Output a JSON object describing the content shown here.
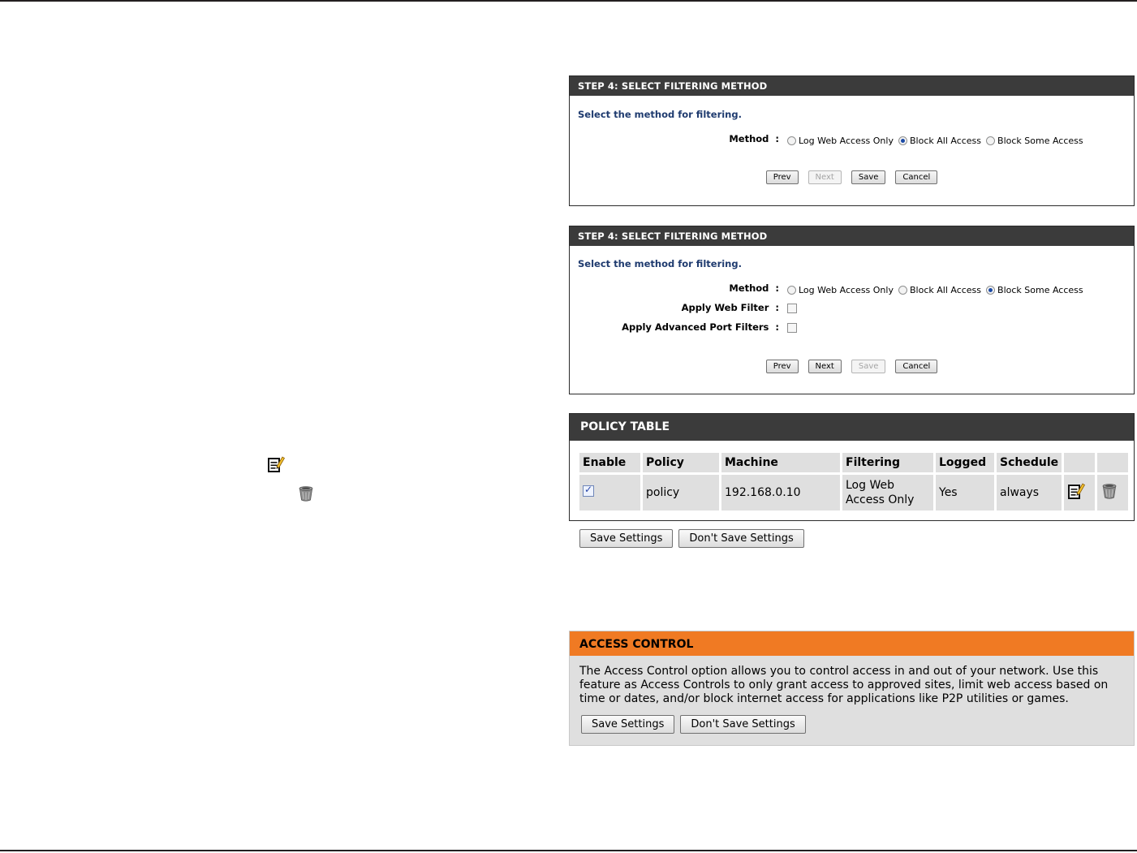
{
  "step_panel_1": {
    "title": "STEP 4: SELECT FILTERING METHOD",
    "subtitle": "Select the method for filtering.",
    "method_label": "Method",
    "options": [
      {
        "label": "Log Web Access Only",
        "selected": false
      },
      {
        "label": "Block All Access",
        "selected": true
      },
      {
        "label": "Block Some Access",
        "selected": false
      }
    ],
    "buttons": {
      "prev": "Prev",
      "next": "Next",
      "save": "Save",
      "cancel": "Cancel"
    }
  },
  "step_panel_2": {
    "title": "STEP 4: SELECT FILTERING METHOD",
    "subtitle": "Select the method for filtering.",
    "method_label": "Method",
    "options": [
      {
        "label": "Log Web Access Only",
        "selected": false
      },
      {
        "label": "Block All Access",
        "selected": false
      },
      {
        "label": "Block Some Access",
        "selected": true
      }
    ],
    "apply_web_filter_label": "Apply Web Filter",
    "apply_port_filters_label": "Apply Advanced Port Filters",
    "buttons": {
      "prev": "Prev",
      "next": "Next",
      "save": "Save",
      "cancel": "Cancel"
    }
  },
  "policy_table": {
    "title": "POLICY TABLE",
    "columns": [
      "Enable",
      "Policy",
      "Machine",
      "Filtering",
      "Logged",
      "Schedule"
    ],
    "rows": [
      {
        "enable": true,
        "policy": "policy",
        "machine": "192.168.0.10",
        "filtering": "Log Web Access Only",
        "logged": "Yes",
        "schedule": "always"
      }
    ],
    "save_label": "Save Settings",
    "dont_save_label": "Don't Save Settings"
  },
  "access_control": {
    "title": "ACCESS CONTROL",
    "description": "The Access Control option allows you to control access in and out of your network. Use this feature as Access Controls to only grant access to approved sites, limit web access based on time or dates, and/or block internet access for applications like P2P utilities or games.",
    "save_label": "Save Settings",
    "dont_save_label": "Don't Save Settings"
  },
  "colors": {
    "panel_header": "#3b3b3b",
    "access_header": "#f07a23",
    "subtitle_blue": "#1f3b6f",
    "cell_gray": "#dfdfdf"
  },
  "icons": {
    "edit": "edit-icon",
    "delete": "trash-icon"
  }
}
